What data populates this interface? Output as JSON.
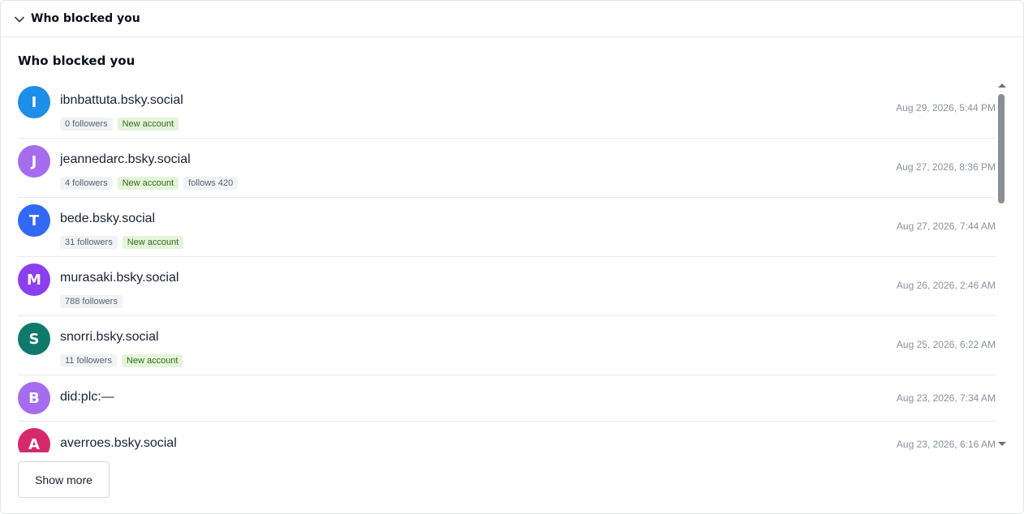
{
  "header": {
    "title": "Who blocked you"
  },
  "section": {
    "title": "Who blocked you"
  },
  "rows": [
    {
      "initial": "I",
      "color": "#1d8fe8",
      "handle": "ibnbattuta.bsky.social",
      "badges": [
        {
          "text": "0 followers",
          "kind": "grey"
        },
        {
          "text": "New account",
          "kind": "green"
        }
      ],
      "time": "Aug 29, 2026, 5:44 PM"
    },
    {
      "initial": "J",
      "color": "#a66cf0",
      "handle": "jeannedarc.bsky.social",
      "badges": [
        {
          "text": "4 followers",
          "kind": "grey"
        },
        {
          "text": "New account",
          "kind": "green"
        },
        {
          "text": "follows 420",
          "kind": "grey"
        }
      ],
      "time": "Aug 27, 2026, 8:36 PM"
    },
    {
      "initial": "T",
      "color": "#3168f5",
      "handle": "bede.bsky.social",
      "badges": [
        {
          "text": "31 followers",
          "kind": "grey"
        },
        {
          "text": "New account",
          "kind": "green"
        }
      ],
      "time": "Aug 27, 2026, 7:44 AM"
    },
    {
      "initial": "M",
      "color": "#8a3ff0",
      "handle": "murasaki.bsky.social",
      "badges": [
        {
          "text": "788 followers",
          "kind": "grey"
        }
      ],
      "time": "Aug 26, 2026, 2:46 AM"
    },
    {
      "initial": "S",
      "color": "#0d7a6c",
      "handle": "snorri.bsky.social",
      "badges": [
        {
          "text": "11 followers",
          "kind": "grey"
        },
        {
          "text": "New account",
          "kind": "green"
        }
      ],
      "time": "Aug 25, 2026, 6:22 AM"
    },
    {
      "initial": "B",
      "color": "#a66cf0",
      "handle": "did:plc:—",
      "badges": [],
      "time": "Aug 23, 2026, 7:34 AM"
    },
    {
      "initial": "A",
      "color": "#d42a6b",
      "handle": "averroes.bsky.social",
      "badges": [],
      "time": "Aug 23, 2026, 6:16 AM"
    }
  ],
  "show_more_label": "Show more"
}
